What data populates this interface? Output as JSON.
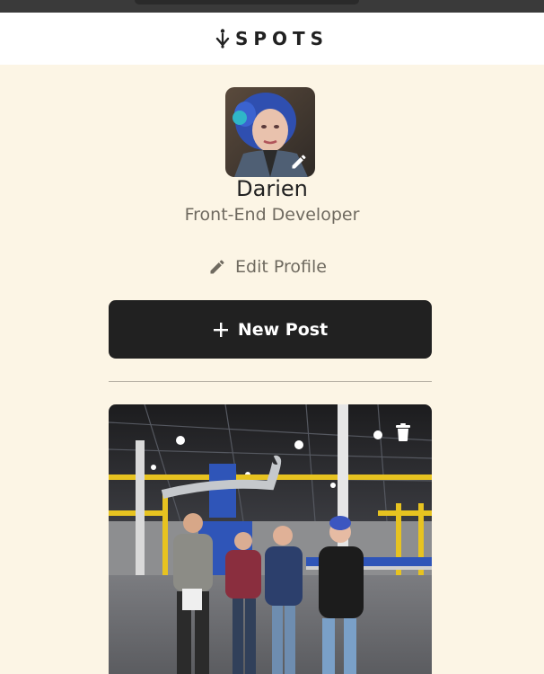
{
  "header": {
    "logo_text": "SPOTS"
  },
  "profile": {
    "name": "Darien",
    "role": "Front-End Developer",
    "edit_profile_label": "Edit Profile"
  },
  "actions": {
    "new_post_label": "New Post"
  },
  "colors": {
    "background": "#fcf5e5",
    "header": "#ffffff",
    "button": "#212121",
    "muted_text": "#6f6a60"
  },
  "icons": {
    "logo": "spots-logo-icon",
    "avatar_edit": "pencil-icon",
    "edit_profile": "pencil-icon",
    "new_post": "plus-icon",
    "delete_post": "trash-icon"
  }
}
